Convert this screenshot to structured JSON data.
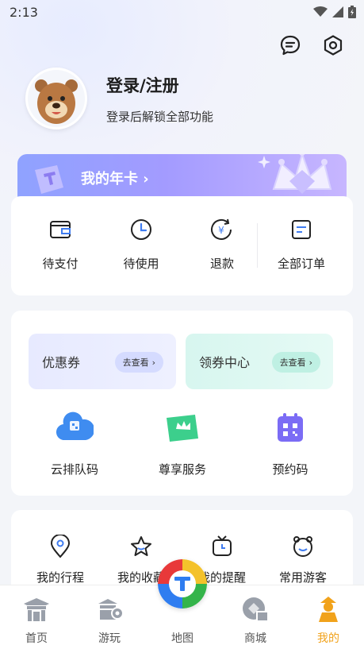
{
  "status_bar": {
    "time": "2:13"
  },
  "header": {
    "icons": [
      "message-icon",
      "settings-hexagon-icon"
    ]
  },
  "profile": {
    "title": "登录/注册",
    "subtitle": "登录后解锁全部功能"
  },
  "annual_card": {
    "label": "我的年卡 ›"
  },
  "orders": [
    {
      "label": "待支付",
      "icon": "wallet-icon"
    },
    {
      "label": "待使用",
      "icon": "clock-icon"
    },
    {
      "label": "退款",
      "icon": "refund-icon"
    },
    {
      "label": "全部订单",
      "icon": "orders-icon"
    }
  ],
  "coupons": [
    {
      "title": "优惠券",
      "action": "去查看"
    },
    {
      "title": "领券中心",
      "action": "去查看"
    }
  ],
  "services": [
    {
      "label": "云排队码",
      "icon": "cloud-queue-icon"
    },
    {
      "label": "尊享服务",
      "icon": "crown-ticket-icon"
    },
    {
      "label": "预约码",
      "icon": "qr-calendar-icon"
    }
  ],
  "tools": [
    {
      "label": "我的行程",
      "icon": "location-pin-icon"
    },
    {
      "label": "我的收藏",
      "icon": "star-icon"
    },
    {
      "label": "我的提醒",
      "icon": "tv-clock-icon"
    },
    {
      "label": "常用游客",
      "icon": "visitor-face-icon"
    }
  ],
  "tabbar": [
    {
      "label": "首页",
      "icon": "home-gate-icon",
      "active": false
    },
    {
      "label": "游玩",
      "icon": "play-pin-icon",
      "active": false
    },
    {
      "label": "地图",
      "icon": "map-icon",
      "active": false
    },
    {
      "label": "商城",
      "icon": "mall-icon",
      "active": false
    },
    {
      "label": "我的",
      "icon": "me-figure-icon",
      "active": true
    }
  ],
  "colors": {
    "accent_active": "#f1a21b",
    "annual_card": "#a39bff",
    "service_blue": "#3f8cf0",
    "service_green": "#3ccf8c",
    "service_purple": "#7b6cf5"
  }
}
